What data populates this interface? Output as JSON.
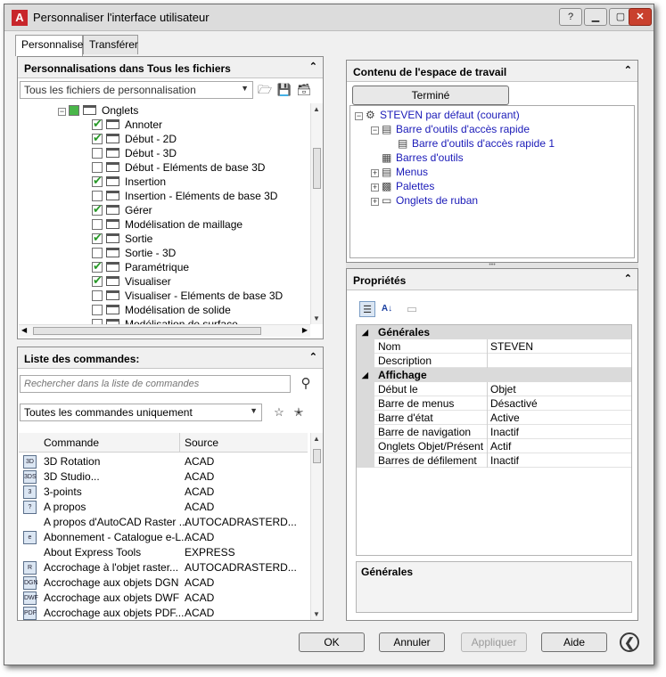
{
  "window": {
    "title": "Personnaliser l'interface utilisateur",
    "app_icon": "A",
    "buttons": [
      "?",
      "▁",
      "▢",
      "✕"
    ]
  },
  "tabs": [
    {
      "label": "Personnaliser",
      "active": true
    },
    {
      "label": "Transférer",
      "active": false
    }
  ],
  "customizations_panel": {
    "title": "Personnalisations dans Tous les fichiers",
    "file_combo": "Tous les fichiers de personnalisation",
    "tree": {
      "root": "Onglets",
      "items": [
        {
          "label": "Annoter",
          "checked": true
        },
        {
          "label": "Début - 2D",
          "checked": true
        },
        {
          "label": "Début - 3D",
          "checked": false
        },
        {
          "label": "Début - Eléments de base 3D",
          "checked": false
        },
        {
          "label": "Insertion",
          "checked": true
        },
        {
          "label": "Insertion - Eléments de base 3D",
          "checked": false
        },
        {
          "label": "Gérer",
          "checked": true
        },
        {
          "label": "Modélisation de maillage",
          "checked": false
        },
        {
          "label": "Sortie",
          "checked": true
        },
        {
          "label": "Sortie - 3D",
          "checked": false
        },
        {
          "label": "Paramétrique",
          "checked": true
        },
        {
          "label": "Visualiser",
          "checked": true
        },
        {
          "label": "Visualiser - Eléments de base 3D",
          "checked": false
        },
        {
          "label": "Modélisation de solide",
          "checked": false
        },
        {
          "label": "Modélisation de surface",
          "checked": false
        }
      ]
    }
  },
  "commands_panel": {
    "title": "Liste des commandes:",
    "search_placeholder": "Rechercher dans la liste de commandes",
    "filter_combo": "Toutes les commandes uniquement",
    "columns": [
      "Commande",
      "Source"
    ],
    "rows": [
      {
        "icon": "3D",
        "command": "3D Rotation",
        "source": "ACAD"
      },
      {
        "icon": "3DS",
        "command": "3D Studio...",
        "source": "ACAD"
      },
      {
        "icon": "3",
        "command": "3-points",
        "source": "ACAD"
      },
      {
        "icon": "?",
        "command": "A propos",
        "source": "ACAD"
      },
      {
        "icon": "",
        "command": "A propos d'AutoCAD Raster ...",
        "source": "AUTOCADRASTERD..."
      },
      {
        "icon": "e",
        "command": "Abonnement - Catalogue e-L...",
        "source": "ACAD"
      },
      {
        "icon": "",
        "command": "About Express Tools",
        "source": "EXPRESS"
      },
      {
        "icon": "R",
        "command": "Accrochage à l'objet raster...",
        "source": "AUTOCADRASTERD..."
      },
      {
        "icon": "DGN",
        "command": "Accrochage aux objets DGN",
        "source": "ACAD"
      },
      {
        "icon": "DWF",
        "command": "Accrochage aux objets DWF",
        "source": "ACAD"
      },
      {
        "icon": "PDF",
        "command": "Accrochage aux objets PDF...",
        "source": "ACAD"
      }
    ]
  },
  "workspace_panel": {
    "title": "Contenu de l'espace de travail",
    "done_button": "Terminé",
    "tree": [
      {
        "label": "STEVEN par défaut (courant)",
        "level": 0,
        "expander": "-",
        "icon": "gear-icon"
      },
      {
        "label": "Barre d'outils d'accès rapide",
        "level": 1,
        "expander": "-",
        "icon": "toolbar-icon"
      },
      {
        "label": "Barre d'outils d'accès rapide 1",
        "level": 2,
        "expander": "",
        "icon": "toolbar-icon"
      },
      {
        "label": "Barres d'outils",
        "level": 1,
        "expander": "",
        "icon": "toolbars-icon"
      },
      {
        "label": "Menus",
        "level": 1,
        "expander": "+",
        "icon": "menu-icon"
      },
      {
        "label": "Palettes",
        "level": 1,
        "expander": "+",
        "icon": "palette-icon"
      },
      {
        "label": "Onglets de ruban",
        "level": 1,
        "expander": "+",
        "icon": "ribbon-tab-icon"
      }
    ]
  },
  "properties_panel": {
    "title": "Propriétés",
    "categories": [
      {
        "name": "Générales",
        "rows": [
          {
            "key": "Nom",
            "value": "STEVEN"
          },
          {
            "key": "Description",
            "value": ""
          }
        ]
      },
      {
        "name": "Affichage",
        "rows": [
          {
            "key": "Début le",
            "value": "Objet"
          },
          {
            "key": "Barre de menus",
            "value": "Désactivé"
          },
          {
            "key": "Barre d'état",
            "value": "Active"
          },
          {
            "key": "Barre de navigation",
            "value": "Inactif"
          },
          {
            "key": "Onglets Objet/Présentation",
            "value": "Actif"
          },
          {
            "key": "Barres de défilement",
            "value": "Inactif"
          }
        ]
      }
    ],
    "description_title": "Générales"
  },
  "footer": {
    "ok": "OK",
    "cancel": "Annuler",
    "apply": "Appliquer",
    "help": "Aide"
  }
}
